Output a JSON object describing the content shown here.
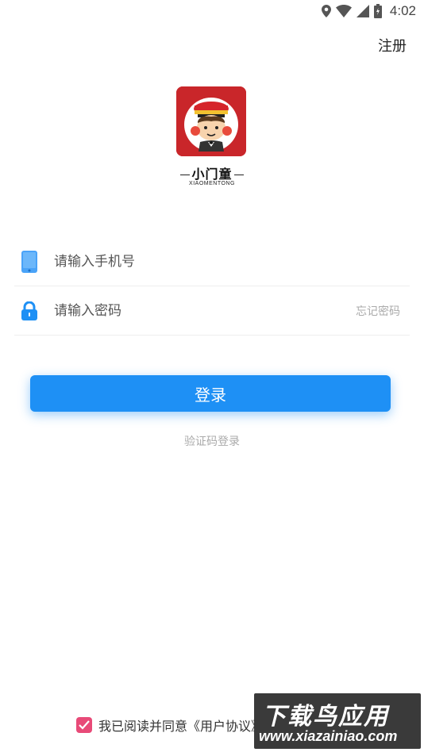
{
  "status_bar": {
    "time": "4:02"
  },
  "header": {
    "register_label": "注册"
  },
  "brand": {
    "name": "小门童",
    "subtitle": "XIAOMENTONG"
  },
  "form": {
    "phone_placeholder": "请输入手机号",
    "password_placeholder": "请输入密码",
    "forgot_label": "忘记密码"
  },
  "actions": {
    "login_label": "登录",
    "sms_login_label": "验证码登录"
  },
  "agreement": {
    "text": "我已阅读并同意《用户协议》和《隐私政策》",
    "checked": true
  },
  "watermark": {
    "title": "下载鸟应用",
    "url": "www.xiazainiao.com"
  },
  "colors": {
    "primary": "#1e90f5",
    "checkbox": "#e84a78",
    "logo_bg": "#c9262a"
  }
}
